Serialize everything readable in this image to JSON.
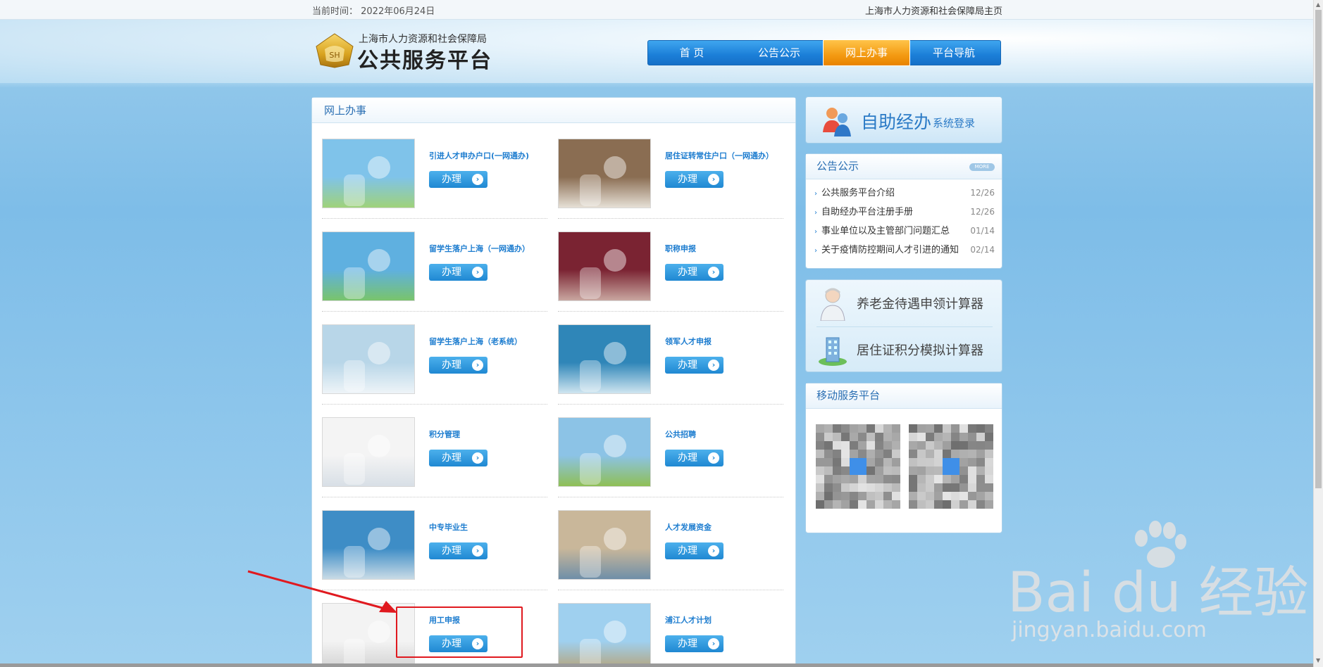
{
  "topbar": {
    "date_text": "当前时间：  2022年06月24日",
    "home_link": "上海市人力资源和社会保障局主页"
  },
  "logo": {
    "subtitle": "上海市人力资源和社会保障局",
    "title": "公共服务平台"
  },
  "nav": {
    "items": [
      "首 页",
      "公告公示",
      "网上办事",
      "平台导航"
    ],
    "active": "网上办事"
  },
  "panel": {
    "title": "网上办事",
    "button_label": "办理",
    "services": [
      {
        "title": "引进人才申办户口(一网通办)"
      },
      {
        "title": "居住证转常住户口（一网通办）"
      },
      {
        "title": "留学生落户上海（一网通办）"
      },
      {
        "title": "职称申报"
      },
      {
        "title": "留学生落户上海（老系统）"
      },
      {
        "title": "领军人才申报"
      },
      {
        "title": "积分管理"
      },
      {
        "title": "公共招聘"
      },
      {
        "title": "中专毕业生"
      },
      {
        "title": "人才发展资金"
      },
      {
        "title": "用工申报"
      },
      {
        "title": "浦江人才计划"
      }
    ]
  },
  "sidebar": {
    "self_service": {
      "big": "自助经办",
      "small": "系统登录"
    },
    "notice": {
      "title": "公告公示",
      "more": "MORE",
      "items": [
        {
          "text": "公共服务平台介绍",
          "date": "12/26"
        },
        {
          "text": "自助经办平台注册手册",
          "date": "12/26"
        },
        {
          "text": "事业单位以及主管部门问题汇总",
          "date": "01/14"
        },
        {
          "text": "关于疫情防控期间人才引进的通知",
          "date": "02/14"
        }
      ]
    },
    "calculators": [
      {
        "label": "养老金待遇申领计算器"
      },
      {
        "label": "居住证积分模拟计算器"
      }
    ],
    "mobile": {
      "title": "移动服务平台"
    }
  },
  "watermark": {
    "text": "Bai du 经验",
    "url": "jingyan.baidu.com"
  },
  "colors": {
    "accent": "#1c7ccf",
    "nav_active": "#f39a12",
    "highlight": "#e0191f"
  }
}
